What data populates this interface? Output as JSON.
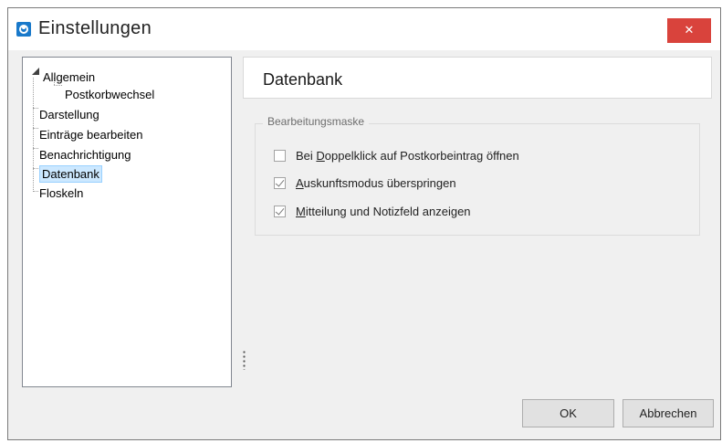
{
  "window": {
    "title": "Einstellungen",
    "close_icon": "close-icon"
  },
  "tree": {
    "items": [
      {
        "label": "Allgemein",
        "expanded": true
      },
      {
        "label": "Postkorbwechsel"
      },
      {
        "label": "Darstellung"
      },
      {
        "label": "Einträge bearbeiten"
      },
      {
        "label": "Benachrichtigung"
      },
      {
        "label": "Datenbank",
        "selected": true
      },
      {
        "label": "Floskeln"
      }
    ]
  },
  "content": {
    "title": "Datenbank",
    "group_label": "Bearbeitungsmaske",
    "options": [
      {
        "label": "Bei Doppelklick auf Postkorbeintrag öffnen",
        "checked": false
      },
      {
        "label": "Auskunftsmodus überspringen",
        "checked": true
      },
      {
        "label": "Mitteilung und Notizfeld anzeigen",
        "checked": true
      }
    ]
  },
  "buttons": {
    "ok": "OK",
    "cancel": "Abbrechen"
  },
  "colors": {
    "accent": "#1979ca",
    "close": "#d9433c",
    "selection": "#cce8ff"
  }
}
